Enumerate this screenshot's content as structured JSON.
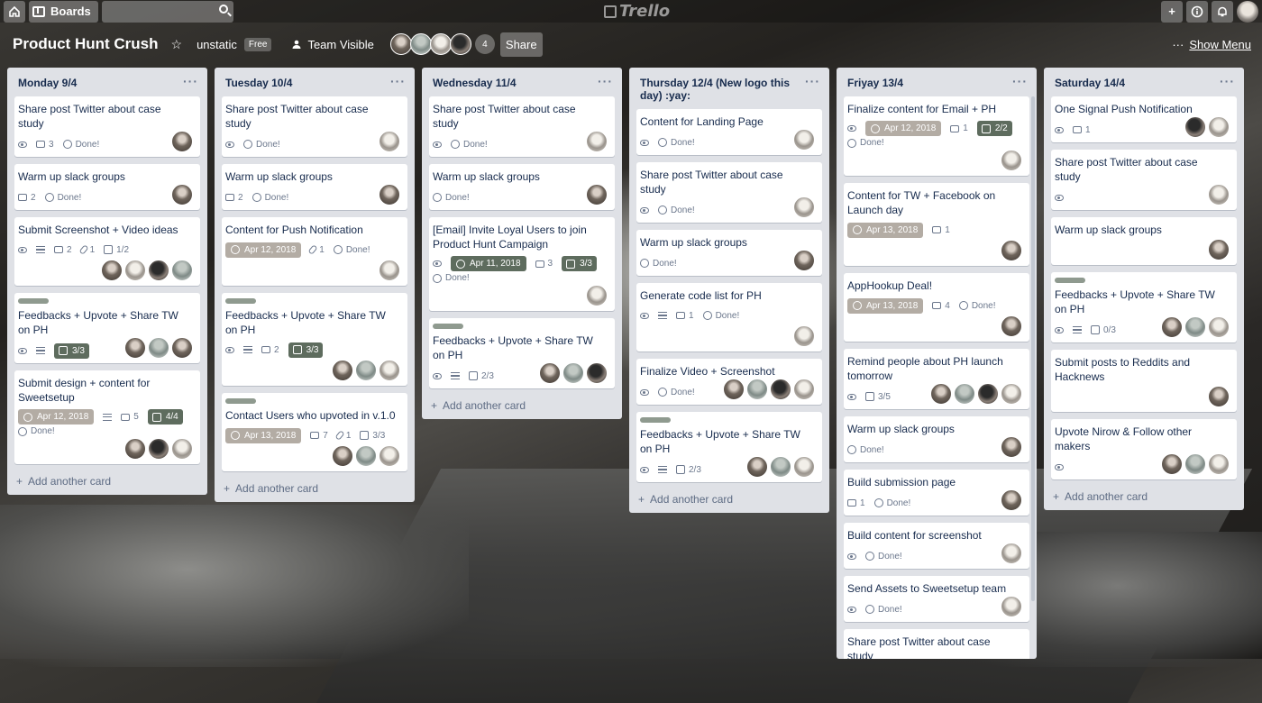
{
  "topbar": {
    "boards_label": "Boards",
    "logo": "Trello",
    "icons": [
      "home-icon",
      "boards-icon",
      "search-icon",
      "plus-icon",
      "info-icon",
      "bell-icon"
    ]
  },
  "board": {
    "title": "Product Hunt Crush",
    "team": "unstatic",
    "plan_badge": "Free",
    "visibility": "Team Visible",
    "member_count": "4",
    "share_label": "Share",
    "show_menu": "Show Menu",
    "menu_dots": "···"
  },
  "add_card_label": "Add another card",
  "lists": [
    {
      "title": "Monday 9/4",
      "cards": [
        {
          "title": "Share post Twitter about case study",
          "comments": "3",
          "done": "Done!"
        },
        {
          "title": "Warm up slack groups",
          "comments": "2",
          "done": "Done!"
        },
        {
          "title": "Submit Screenshot + Video ideas",
          "comments": "2",
          "attachments": "1",
          "checklist": "1/2"
        },
        {
          "title": "Feedbacks + Upvote + Share TW on PH",
          "checklist": "3/3"
        },
        {
          "title": "Submit design + content for Sweetsetup",
          "due": "Apr 12, 2018",
          "comments": "5",
          "checklist": "4/4",
          "done": "Done!"
        }
      ]
    },
    {
      "title": "Tuesday 10/4",
      "cards": [
        {
          "title": "Share post Twitter about case study",
          "done": "Done!"
        },
        {
          "title": "Warm up slack groups",
          "comments": "2",
          "done": "Done!"
        },
        {
          "title": "Content for Push Notification",
          "due": "Apr 12, 2018",
          "attachments": "1",
          "done": "Done!"
        },
        {
          "title": "Feedbacks + Upvote + Share TW on PH",
          "comments": "2",
          "checklist": "3/3"
        },
        {
          "title": "Contact Users who upvoted in v.1.0",
          "due": "Apr 13, 2018",
          "comments": "7",
          "attachments": "1",
          "checklist": "3/3"
        }
      ]
    },
    {
      "title": "Wednesday 11/4",
      "cards": [
        {
          "title": "Share post Twitter about case study",
          "done": "Done!"
        },
        {
          "title": "Warm up slack groups",
          "done": "Done!"
        },
        {
          "title": "[Email] Invite Loyal Users to join Product Hunt Campaign",
          "due": "Apr 11, 2018",
          "comments": "3",
          "checklist": "3/3",
          "done": "Done!"
        },
        {
          "title": "Feedbacks + Upvote + Share TW on PH",
          "checklist": "2/3"
        }
      ]
    },
    {
      "title": "Thursday 12/4 (New logo this day) :yay:",
      "cards": [
        {
          "title": "Content for Landing Page",
          "done": "Done!"
        },
        {
          "title": "Share post Twitter about case study",
          "done": "Done!"
        },
        {
          "title": "Warm up slack groups",
          "done": "Done!"
        },
        {
          "title": "Generate code list for PH",
          "comments": "1",
          "done": "Done!"
        },
        {
          "title": "Finalize Video + Screenshot",
          "done": "Done!"
        },
        {
          "title": "Feedbacks + Upvote + Share TW on PH",
          "checklist": "2/3"
        }
      ]
    },
    {
      "title": "Friyay 13/4",
      "cards": [
        {
          "title": "Finalize content for Email + PH",
          "due": "Apr 12, 2018",
          "comments": "1",
          "checklist": "2/2",
          "done": "Done!"
        },
        {
          "title": "Content for TW + Facebook on Launch day",
          "due": "Apr 13, 2018",
          "comments": "1"
        },
        {
          "title": "AppHookup Deal!",
          "due": "Apr 13, 2018",
          "comments": "4",
          "done": "Done!"
        },
        {
          "title": "Remind people about PH launch tomorrow",
          "checklist": "3/5"
        },
        {
          "title": "Warm up slack groups",
          "done": "Done!"
        },
        {
          "title": "Build submission page",
          "comments": "1",
          "done": "Done!"
        },
        {
          "title": "Build content for screenshot",
          "done": "Done!"
        },
        {
          "title": "Send Assets to Sweetsetup team",
          "done": "Done!"
        },
        {
          "title": "Share post Twitter about case study"
        }
      ]
    },
    {
      "title": "Saturday 14/4",
      "cards": [
        {
          "title": "One Signal Push Notification",
          "comments": "1"
        },
        {
          "title": "Share post Twitter about case study"
        },
        {
          "title": "Warm up slack groups"
        },
        {
          "title": "Feedbacks + Upvote + Share TW on PH",
          "checklist": "0/3"
        },
        {
          "title": "Submit posts to Reddits and Hacknews"
        },
        {
          "title": "Upvote Nirow & Follow other makers"
        }
      ]
    }
  ]
}
